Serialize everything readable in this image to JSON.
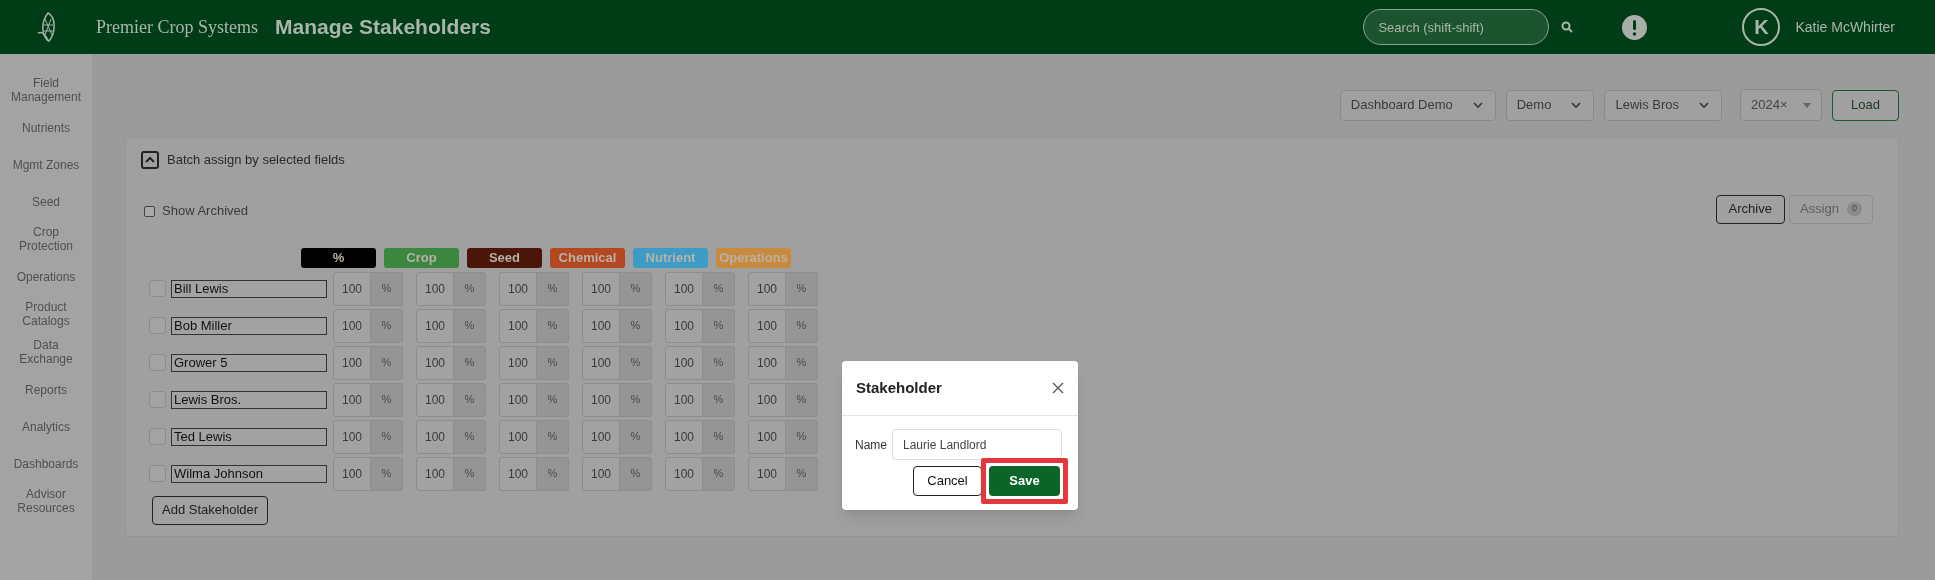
{
  "header": {
    "brand": "Premier Crop Systems",
    "title": "Manage Stakeholders",
    "search": {
      "placeholder": "Search (shift-shift)"
    },
    "avatar": "K",
    "user": "Katie McWhirter"
  },
  "sidebar": {
    "items": [
      {
        "label": "Field Management"
      },
      {
        "label": "Nutrients"
      },
      {
        "label": "Mgmt Zones"
      },
      {
        "label": "Seed"
      },
      {
        "label": "Crop Protection"
      },
      {
        "label": "Operations"
      },
      {
        "label": "Product Catalogs"
      },
      {
        "label": "Data Exchange"
      },
      {
        "label": "Reports"
      },
      {
        "label": "Analytics"
      },
      {
        "label": "Dashboards"
      },
      {
        "label": "Advisor Resources"
      }
    ]
  },
  "filters": [
    {
      "value": "Dashboard Demo"
    },
    {
      "value": "Demo"
    },
    {
      "value": "Lewis Bros"
    }
  ],
  "year": {
    "value": "2024×"
  },
  "load_button": "Load",
  "panel": {
    "toggle": {
      "label": "Batch assign by selected fields",
      "expanded": true
    },
    "show_archived": {
      "label": "Show Archived",
      "checked": false
    },
    "archive_button": "Archive",
    "assign_button": {
      "label": "Assign",
      "count": "0",
      "disabled": true
    },
    "columns": [
      {
        "label": "%",
        "color": "#000000"
      },
      {
        "label": "Crop",
        "color": "#3c873f"
      },
      {
        "label": "Seed",
        "color": "#4a160a"
      },
      {
        "label": "Chemical",
        "color": "#b3471f"
      },
      {
        "label": "Nutrient",
        "color": "#3c9cc6"
      },
      {
        "label": "Operations",
        "color": "#c88b3e"
      }
    ],
    "rows": [
      {
        "selected": false,
        "name": "Bill Lewis",
        "cells": [
          {
            "value": "100",
            "unit": "%"
          },
          {
            "value": "100",
            "unit": "%"
          },
          {
            "value": "100",
            "unit": "%"
          },
          {
            "value": "100",
            "unit": "%"
          },
          {
            "value": "100",
            "unit": "%"
          },
          {
            "value": "100",
            "unit": "%"
          }
        ]
      },
      {
        "selected": false,
        "name": "Bob Miller",
        "cells": [
          {
            "value": "100",
            "unit": "%"
          },
          {
            "value": "100",
            "unit": "%"
          },
          {
            "value": "100",
            "unit": "%"
          },
          {
            "value": "100",
            "unit": "%"
          },
          {
            "value": "100",
            "unit": "%"
          },
          {
            "value": "100",
            "unit": "%"
          }
        ]
      },
      {
        "selected": false,
        "name": "Grower 5",
        "cells": [
          {
            "value": "100",
            "unit": "%"
          },
          {
            "value": "100",
            "unit": "%"
          },
          {
            "value": "100",
            "unit": "%"
          },
          {
            "value": "100",
            "unit": "%"
          },
          {
            "value": "100",
            "unit": "%"
          },
          {
            "value": "100",
            "unit": "%"
          }
        ]
      },
      {
        "selected": false,
        "name": "Lewis Bros.",
        "cells": [
          {
            "value": "100",
            "unit": "%"
          },
          {
            "value": "100",
            "unit": "%"
          },
          {
            "value": "100",
            "unit": "%"
          },
          {
            "value": "100",
            "unit": "%"
          },
          {
            "value": "100",
            "unit": "%"
          },
          {
            "value": "100",
            "unit": "%"
          }
        ]
      },
      {
        "selected": false,
        "name": "Ted Lewis",
        "cells": [
          {
            "value": "100",
            "unit": "%"
          },
          {
            "value": "100",
            "unit": "%"
          },
          {
            "value": "100",
            "unit": "%"
          },
          {
            "value": "100",
            "unit": "%"
          },
          {
            "value": "100",
            "unit": "%"
          },
          {
            "value": "100",
            "unit": "%"
          }
        ]
      },
      {
        "selected": false,
        "name": "Wilma Johnson",
        "cells": [
          {
            "value": "100",
            "unit": "%"
          },
          {
            "value": "100",
            "unit": "%"
          },
          {
            "value": "100",
            "unit": "%"
          },
          {
            "value": "100",
            "unit": "%"
          },
          {
            "value": "100",
            "unit": "%"
          },
          {
            "value": "100",
            "unit": "%"
          }
        ]
      }
    ],
    "add_button": "Add Stakeholder"
  },
  "dialog": {
    "title": "Stakeholder",
    "name_label": "Name",
    "name_value": "Laurie Landlord",
    "cancel_button": "Cancel",
    "save_button": {
      "label": "Save",
      "highlighted": true
    }
  }
}
